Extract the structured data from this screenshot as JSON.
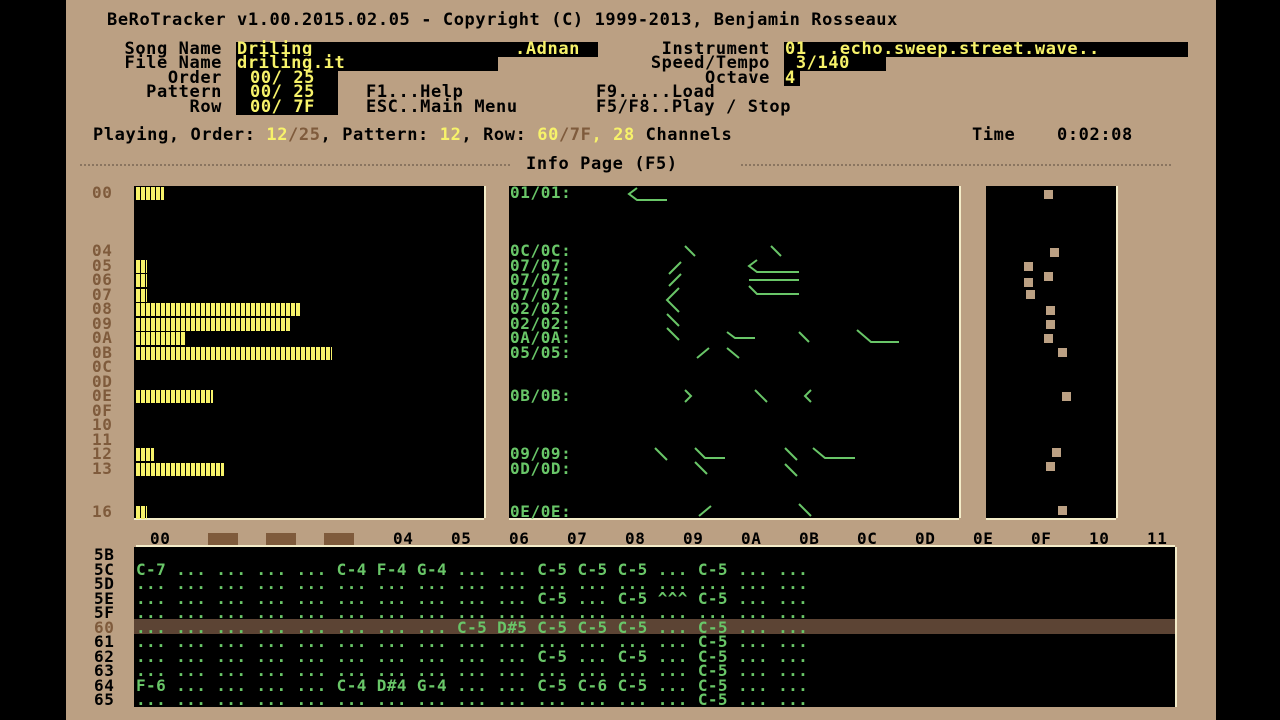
{
  "title": "BeRoTracker v1.00.2015.02.05 - Copyright (C) 1999-2013, Benjamin Rosseaux",
  "labels": {
    "song_name": "Song Name",
    "file_name": "File Name",
    "order": "Order",
    "pattern": "Pattern",
    "row": "Row",
    "instrument": "Instrument",
    "speed_tempo": "Speed/Tempo",
    "octave": "Octave"
  },
  "values": {
    "song_name": "Driling",
    "song_name_suffix": ".Adnan",
    "file_name": "driling.it",
    "order": "00/ 25",
    "pattern": "00/ 25",
    "row": "00/ 7F",
    "instrument_num": "01",
    "instrument_name": ".echo.sweep.street.wave..",
    "speed_tempo": " 3/140",
    "octave": "4"
  },
  "help": {
    "f1": "F1...Help",
    "esc": "ESC..Main Menu",
    "f9": "F9.....Load",
    "f5f8": "F5/F8..Play / Stop"
  },
  "status": {
    "playing_order_label": "Playing, Order: ",
    "order_cur": "12",
    "order_total": "/25",
    "pattern_label": ", Pattern: ",
    "pattern_cur": "12",
    "row_label": ", Row: ",
    "row_cur": "60",
    "row_total": "/7F",
    "channels_num": ", 28",
    "channels_label": " Channels",
    "time_label": "Time",
    "time_value": "0:02:08"
  },
  "info_page_title": "Info Page (F5)",
  "vu": [
    {
      "ch": "00",
      "level": 0.08
    },
    {
      "ch": "04",
      "level": 0
    },
    {
      "ch": "05",
      "level": 0.03
    },
    {
      "ch": "06",
      "level": 0.03
    },
    {
      "ch": "07",
      "level": 0.03
    },
    {
      "ch": "08",
      "level": 0.47
    },
    {
      "ch": "09",
      "level": 0.44
    },
    {
      "ch": "0A",
      "level": 0.14
    },
    {
      "ch": "0B",
      "level": 0.56
    },
    {
      "ch": "0C",
      "level": 0
    },
    {
      "ch": "0D",
      "level": 0
    },
    {
      "ch": "0E",
      "level": 0.22
    },
    {
      "ch": "0F",
      "level": 0
    },
    {
      "ch": "10",
      "level": 0
    },
    {
      "ch": "11",
      "level": 0
    },
    {
      "ch": "12",
      "level": 0.05
    },
    {
      "ch": "13",
      "level": 0.25
    },
    {
      "ch": "16",
      "level": 0.03
    }
  ],
  "sample_labels": [
    "01/01:",
    "0C/0C:",
    "07/07:",
    "07/07:",
    "07/07:",
    "02/02:",
    "02/02:",
    "0A/0A:",
    "05/05:",
    "0B/0B:",
    "09/09:",
    "0D/0D:",
    "0E/0E:"
  ],
  "pattern": {
    "channel_headers": [
      "00",
      "04",
      "05",
      "06",
      "07",
      "08",
      "09",
      "0A",
      "0B",
      "0C",
      "0D",
      "0E",
      "0F",
      "10",
      "11"
    ],
    "row_numbers": [
      "5B",
      "5C",
      "5D",
      "5E",
      "5F",
      "60",
      "61",
      "62",
      "63",
      "64",
      "65"
    ],
    "current_row": "60",
    "rows": [
      "",
      "C-7 ... ... ... ... C-4 F-4 G-4 ... ... C-5 C-5 C-5 ... C-5 ... ...",
      "... ... ... ... ... ... ... ... ... ... ... ... ... ... ... ... ...",
      "... ... ... ... ... ... ... ... ... ... C-5 ... C-5 ^^^ C-5 ... ...",
      "... ... ... ... ... ... ... ... ... ... ... ... ... ... ... ... ...",
      "... ... ... ... ... ... ... ... C-5 D#5 C-5 C-5 C-5 ... C-5 ... ...",
      "... ... ... ... ... ... ... ... ... ... ... ... ... ... C-5 ... ...",
      "... ... ... ... ... ... ... ... ... ... C-5 ... C-5 ... C-5 ... ...",
      "... ... ... ... ... ... ... ... ... ... ... ... ... ... C-5 ... ...",
      "F-6 ... ... ... ... C-4 D#4 G-4 ... ... C-5 C-6 C-5 ... C-5 ... ...",
      "... ... ... ... ... ... ... ... ... ... ... ... ... ... C-5 ... ..."
    ]
  }
}
